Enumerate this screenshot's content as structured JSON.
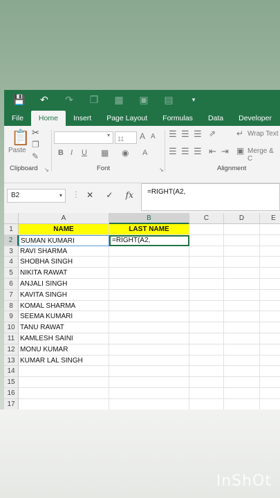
{
  "tabs": [
    "File",
    "Home",
    "Insert",
    "Page Layout",
    "Formulas",
    "Data",
    "Developer"
  ],
  "active_tab": "Home",
  "ribbon": {
    "paste_label": "Paste",
    "clipboard_label": "Clipboard",
    "font_label": "Font",
    "font_size": "11",
    "bold": "B",
    "italic": "I",
    "underline": "U",
    "grow_font": "A",
    "shrink_font": "A",
    "font_color_label": "A",
    "wrap_text": "Wrap Text",
    "merge": "Merge & C",
    "alignment_label": "Alignment"
  },
  "formula_bar": {
    "name_box": "B2",
    "cancel": "✕",
    "enter": "✓",
    "fx": "fx",
    "formula": "=RIGHT(A2,"
  },
  "columns": [
    "A",
    "B",
    "C",
    "D",
    "E"
  ],
  "rows": [
    "1",
    "2",
    "3",
    "4",
    "5",
    "6",
    "7",
    "8",
    "9",
    "10",
    "11",
    "12",
    "13",
    "14",
    "15",
    "16",
    "17"
  ],
  "header_row": {
    "A": "NAME",
    "B": "LAST NAME"
  },
  "names": [
    "SUMAN KUMARI",
    "RAVI SHARMA",
    "SHOBHA SINGH",
    "NIKITA RAWAT",
    "ANJALI SINGH",
    "KAVITA SINGH",
    "KOMAL SHARMA",
    "SEEMA KUMARI",
    "TANU RAWAT",
    "KAMLESH SAINI",
    "MONU KUMAR",
    "KUMAR LAL SINGH"
  ],
  "active_cell_text": "=RIGHT(A2,",
  "watermark": "InShOt"
}
